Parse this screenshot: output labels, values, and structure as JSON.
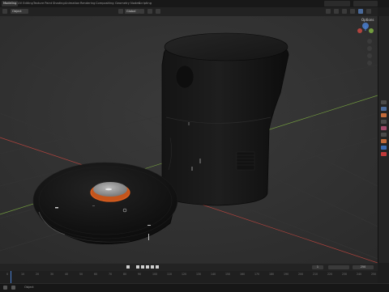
{
  "workspace_tabs": [
    "Modeling",
    "UV Editing",
    "Texture Paint",
    "Shading",
    "Animation",
    "Rendering",
    "Compositing",
    "Geometry Nodes",
    "Scripting"
  ],
  "viewport_header": {
    "mode": "Object",
    "shading": "Global"
  },
  "gizmo": {
    "label": "Options"
  },
  "timeline": {
    "ticks": [
      "0",
      "10",
      "20",
      "30",
      "40",
      "50",
      "60",
      "70",
      "80",
      "90",
      "100",
      "110",
      "120",
      "130",
      "140",
      "150",
      "160",
      "170",
      "180",
      "190",
      "200",
      "210",
      "220",
      "230",
      "240",
      "250"
    ],
    "start_field": "1",
    "end_field": "250"
  },
  "status_bar": {
    "text": "Object"
  },
  "colors": {
    "accent": "#4a7fd0",
    "robot_ring": "#e0601f",
    "axis_x": "#c8463f",
    "axis_y": "#7fb042"
  }
}
